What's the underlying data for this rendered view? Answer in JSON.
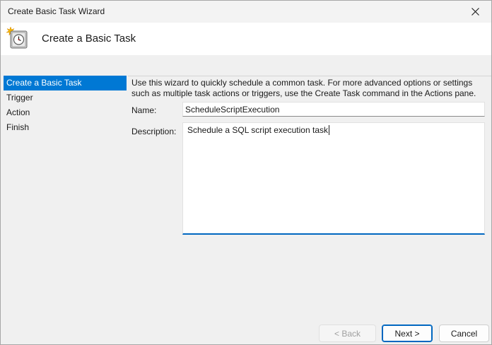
{
  "window": {
    "title": "Create Basic Task Wizard"
  },
  "header": {
    "title": "Create a Basic Task"
  },
  "steps": [
    {
      "label": "Create a Basic Task"
    },
    {
      "label": "Trigger"
    },
    {
      "label": "Action"
    },
    {
      "label": "Finish"
    }
  ],
  "main": {
    "intro_line1": "Use this wizard to quickly schedule a common task.  For more advanced options or settings",
    "intro_line2": "such as multiple task actions or triggers, use the Create Task command in the Actions pane.",
    "name_label": "Name:",
    "name_value": "ScheduleScriptExecution",
    "description_label": "Description:",
    "description_value": "Schedule a SQL script execution task"
  },
  "footer": {
    "back_label": "< Back",
    "next_label": "Next >",
    "cancel_label": "Cancel"
  },
  "colors": {
    "accent": "#0078d4",
    "focus_border": "#0067c0"
  },
  "icons": {
    "header": "task-scheduler-clock-icon",
    "close": "close-icon"
  }
}
